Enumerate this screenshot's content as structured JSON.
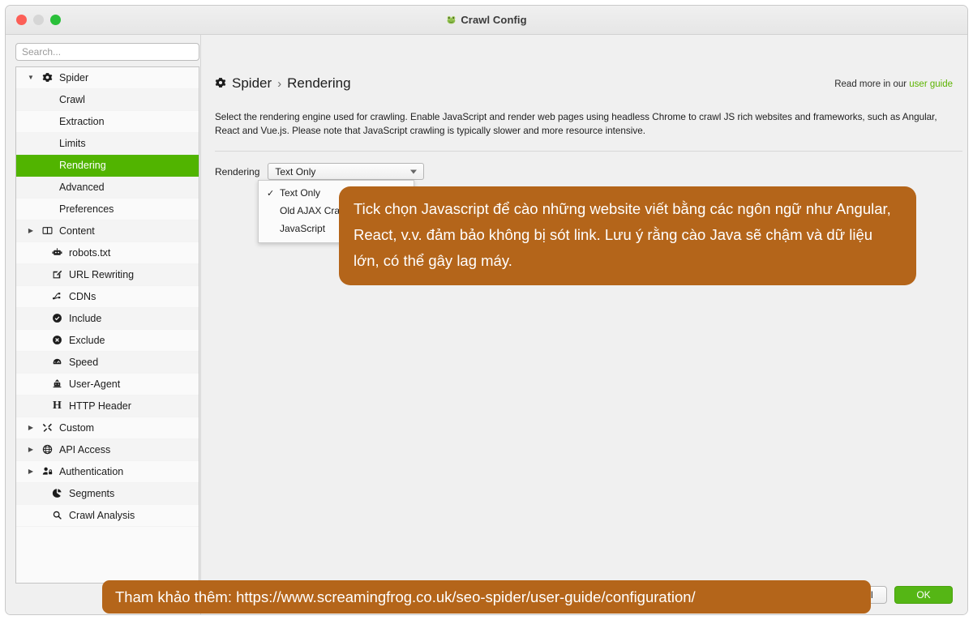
{
  "window": {
    "title": "Crawl Config",
    "title_icon": "frog-icon",
    "traffic_lights": [
      "close",
      "minimize",
      "zoom"
    ]
  },
  "sidebar": {
    "search": {
      "placeholder": "Search...",
      "value": ""
    },
    "items": [
      {
        "label": "Spider",
        "icon": "gear-icon",
        "level": 0,
        "twisty": "▼",
        "selected": false
      },
      {
        "label": "Crawl",
        "icon": "",
        "level": 1,
        "twisty": "",
        "selected": false
      },
      {
        "label": "Extraction",
        "icon": "",
        "level": 1,
        "twisty": "",
        "selected": false
      },
      {
        "label": "Limits",
        "icon": "",
        "level": 1,
        "twisty": "",
        "selected": false
      },
      {
        "label": "Rendering",
        "icon": "",
        "level": 1,
        "twisty": "",
        "selected": true
      },
      {
        "label": "Advanced",
        "icon": "",
        "level": 1,
        "twisty": "",
        "selected": false
      },
      {
        "label": "Preferences",
        "icon": "",
        "level": 1,
        "twisty": "",
        "selected": false
      },
      {
        "label": "Content",
        "icon": "columns-icon",
        "level": 0,
        "twisty": "▶",
        "selected": false
      },
      {
        "label": "robots.txt",
        "icon": "robot-icon",
        "level": 2,
        "twisty": "",
        "selected": false
      },
      {
        "label": "URL Rewriting",
        "icon": "pencil-box-icon",
        "level": 2,
        "twisty": "",
        "selected": false
      },
      {
        "label": "CDNs",
        "icon": "network-icon",
        "level": 2,
        "twisty": "",
        "selected": false
      },
      {
        "label": "Include",
        "icon": "check-circle-icon",
        "level": 2,
        "twisty": "",
        "selected": false
      },
      {
        "label": "Exclude",
        "icon": "x-circle-icon",
        "level": 2,
        "twisty": "",
        "selected": false
      },
      {
        "label": "Speed",
        "icon": "gauge-icon",
        "level": 2,
        "twisty": "",
        "selected": false
      },
      {
        "label": "User-Agent",
        "icon": "robot-head-icon",
        "level": 2,
        "twisty": "",
        "selected": false
      },
      {
        "label": "HTTP Header",
        "icon": "h-letter-icon",
        "level": 2,
        "twisty": "",
        "selected": false
      },
      {
        "label": "Custom",
        "icon": "tools-icon",
        "level": 0,
        "twisty": "▶",
        "selected": false
      },
      {
        "label": "API Access",
        "icon": "globe-icon",
        "level": 0,
        "twisty": "▶",
        "selected": false
      },
      {
        "label": "Authentication",
        "icon": "user-lock-icon",
        "level": 0,
        "twisty": "▶",
        "selected": false
      },
      {
        "label": "Segments",
        "icon": "pie-chart-icon",
        "level": 2,
        "twisty": "",
        "selected": false
      },
      {
        "label": "Crawl Analysis",
        "icon": "search-icon",
        "level": 2,
        "twisty": "",
        "selected": false
      }
    ]
  },
  "main": {
    "breadcrumb": {
      "icon": "gear-icon",
      "root": "Spider",
      "separator": "›",
      "leaf": "Rendering"
    },
    "read_more": {
      "prefix": "Read more in our ",
      "link": "user guide"
    },
    "description": "Select the rendering engine used for crawling. Enable JavaScript and render web pages using headless Chrome to crawl JS rich websites and frameworks, such as Angular, React and Vue.js. Please note that JavaScript crawling is typically slower and more resource intensive.",
    "field": {
      "label": "Rendering",
      "selected_value": "Text Only",
      "caret_icon": "chevron-down-icon",
      "options": [
        {
          "label": "Text Only",
          "checked": true
        },
        {
          "label": "Old AJAX Crawling Scheme",
          "checked": false
        },
        {
          "label": "JavaScript",
          "checked": false
        }
      ],
      "check_glyph": "✓"
    },
    "footer": {
      "cancel_label": "Cancel",
      "ok_label": "OK"
    }
  },
  "annotations": {
    "callout": "Tick chọn Javascript để cào những website viết bằng các ngôn ngữ như Angular, React, v.v. đảm bảo không bị sót link. Lưu ý rằng cào Java sẽ chậm và dữ liệu lớn, có thể gây lag máy.",
    "banner": "Tham khảo thêm: https://www.screamingfrog.co.uk/seo-spider/user-guide/configuration/"
  },
  "colors": {
    "accent_green": "#51b400",
    "link_green": "#5cb300",
    "annotation_orange": "#b4651a",
    "window_bg": "#f0f0f0"
  }
}
